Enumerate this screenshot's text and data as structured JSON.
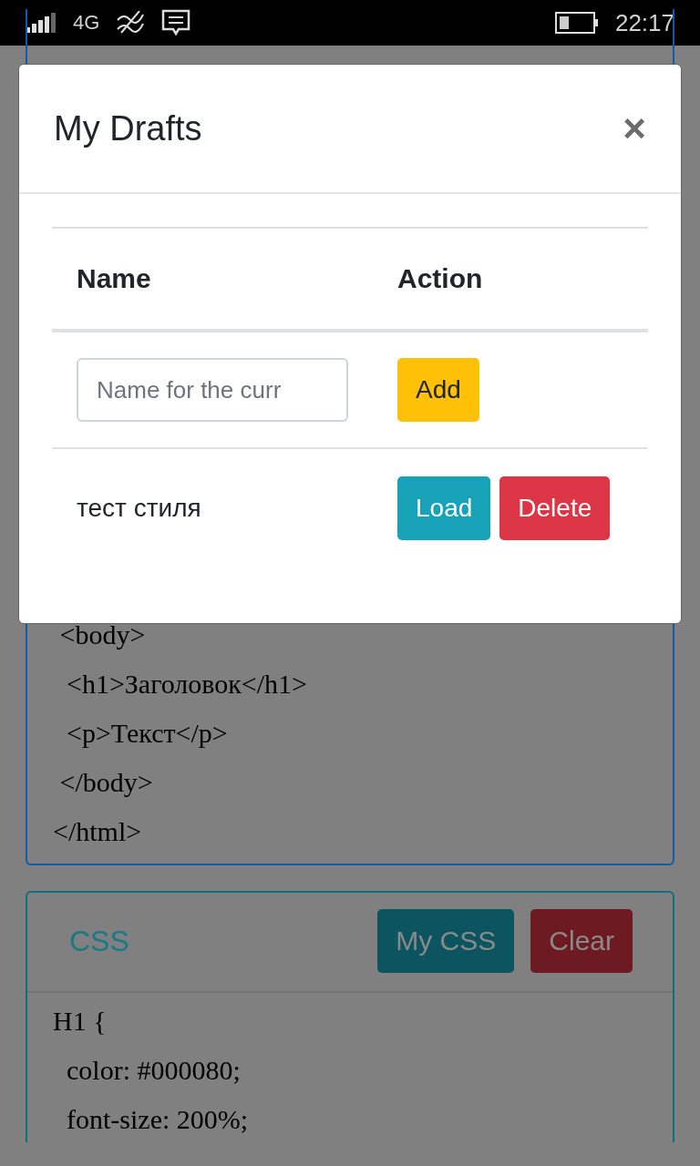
{
  "status_bar": {
    "network": "4G",
    "time": "22:17"
  },
  "html_panel": {
    "lines": [
      " <body>",
      "  <h1>Заголовок</h1>",
      "  <p>Текст</p>",
      " </body>",
      "</html>"
    ]
  },
  "css_panel": {
    "title": "CSS",
    "buttons": [
      {
        "label": "My CSS",
        "kind": "info"
      },
      {
        "label": "Clear",
        "kind": "danger"
      }
    ],
    "lines": [
      "H1 {",
      "  color: #000080;",
      "  font-size: 200%;"
    ]
  },
  "modal": {
    "title": "My Drafts",
    "close": "×",
    "table": {
      "columns": [
        "Name",
        "Action"
      ],
      "new_row": {
        "placeholder": "Name for the curr",
        "button": {
          "label": "Add",
          "kind": "warning"
        }
      },
      "rows": [
        {
          "name": "тест стиля",
          "buttons": [
            {
              "label": "Load",
              "kind": "info"
            },
            {
              "label": "Delete",
              "kind": "danger"
            }
          ]
        }
      ]
    }
  }
}
